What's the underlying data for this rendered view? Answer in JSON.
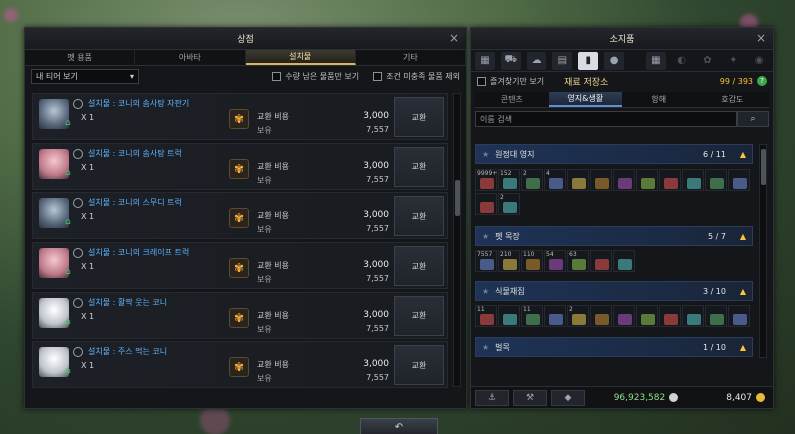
{
  "shop": {
    "title": "상점",
    "tabs": [
      "펫 용품",
      "아바타",
      "설치물",
      "기타"
    ],
    "active_tab": 2,
    "filter_select": "내 티어 보기",
    "filter_remaining": "수량 남은 물품만 보기",
    "filter_condition": "조건 미충족 물품 제외",
    "cost_label": "교환 비용",
    "own_label": "보유",
    "exchange_label": "교환",
    "items": [
      {
        "name": "설치물 : 코니의 솜사탕 자판기",
        "qty": "X 1",
        "cost": "3,000",
        "own": "7,557",
        "thumb": "blue"
      },
      {
        "name": "설치물 : 코니의 솜사탕 트럭",
        "qty": "X 1",
        "cost": "3,000",
        "own": "7,557",
        "thumb": "pink"
      },
      {
        "name": "설치물 : 코니의 스무디 트럭",
        "qty": "X 1",
        "cost": "3,000",
        "own": "7,557",
        "thumb": "blue"
      },
      {
        "name": "설치물 : 코니의 크레이프 트럭",
        "qty": "X 1",
        "cost": "3,000",
        "own": "7,557",
        "thumb": "pink"
      },
      {
        "name": "설치물 : 활짝 웃는 코니",
        "qty": "X 1",
        "cost": "3,000",
        "own": "7,557",
        "thumb": "white"
      },
      {
        "name": "설치물 : 주스 먹는 코니",
        "qty": "X 1",
        "cost": "3,000",
        "own": "7,557",
        "thumb": "white"
      }
    ]
  },
  "inventory": {
    "title": "소지품",
    "favorites_label": "즐겨찾기만 보기",
    "storage_title": "재료 저장소",
    "capacity": "99 / 393",
    "help": "?",
    "tabs": [
      "콘텐츠",
      "영지&생활",
      "항해",
      "호감도"
    ],
    "active_tab": 1,
    "search_placeholder": "이름 검색",
    "categories": [
      {
        "name": "원정대 영지",
        "count": "6 / 11"
      },
      {
        "name": "펫 목장",
        "count": "5 / 7"
      },
      {
        "name": "식물채집",
        "count": "3 / 10"
      },
      {
        "name": "벌목",
        "count": "1 / 10"
      }
    ],
    "slots_row1": [
      "9999+",
      "152",
      "2",
      "4",
      "",
      "",
      "",
      "",
      "",
      "",
      "",
      ""
    ],
    "slots_row2": [
      "",
      "2"
    ],
    "slots_row3": [
      "7557",
      "210",
      "110",
      "54",
      "63",
      "",
      ""
    ],
    "slots_row4": [
      "11",
      "",
      "11",
      "",
      "2",
      "",
      "",
      "",
      "",
      "",
      "",
      ""
    ],
    "silver": "96,923,582",
    "gold": "8,407",
    "colors": {
      "silver": "#8fe08a",
      "gold_coin": "#e8b93a",
      "silver_coin": "#cfd3d8"
    }
  },
  "back_button": "↶"
}
